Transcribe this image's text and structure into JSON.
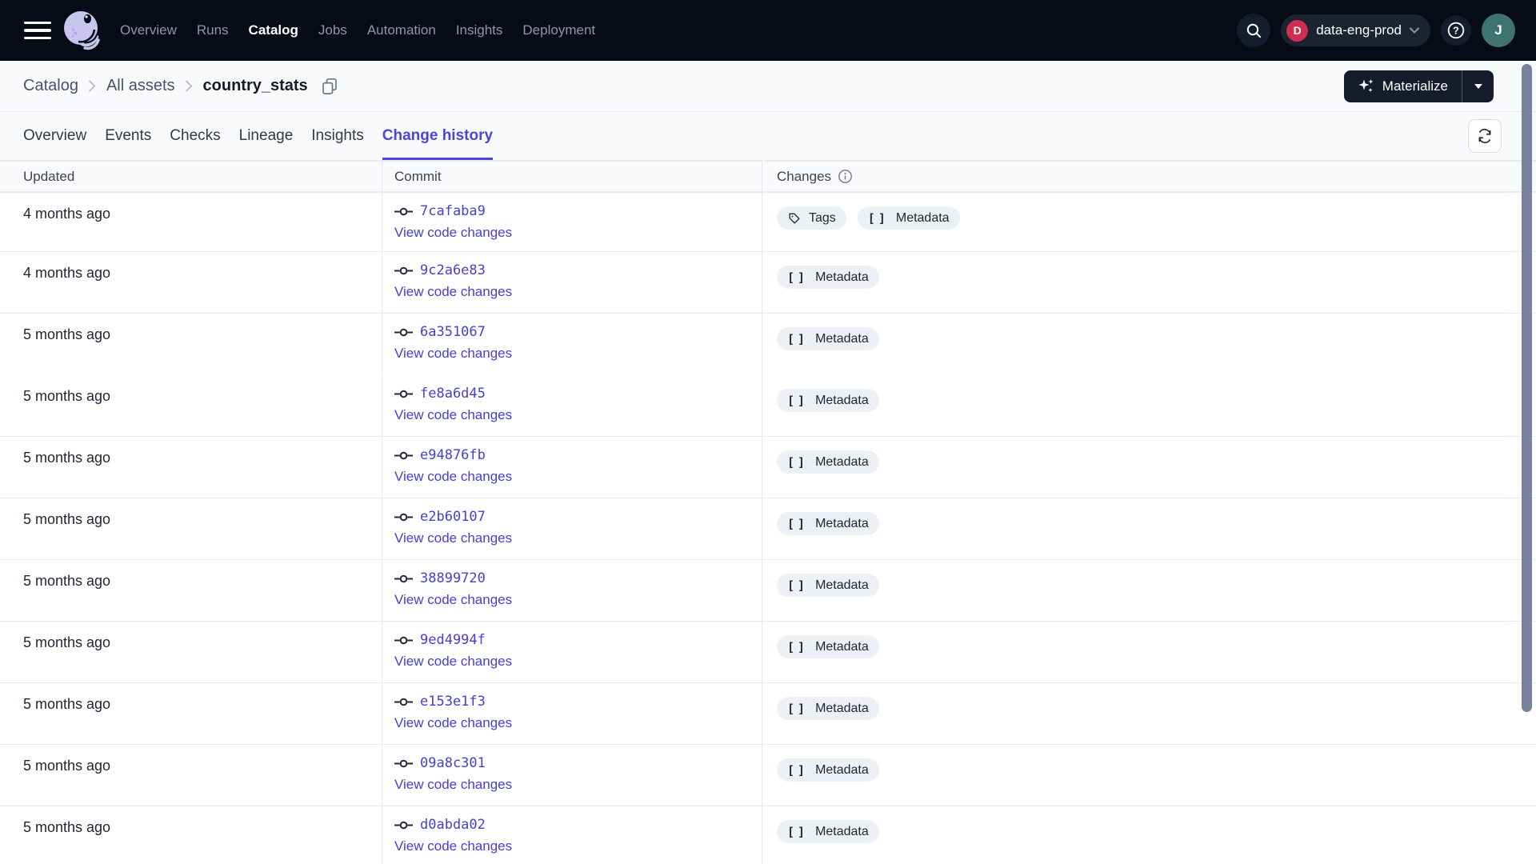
{
  "nav": {
    "items": [
      {
        "label": "Overview",
        "active": false
      },
      {
        "label": "Runs",
        "active": false
      },
      {
        "label": "Catalog",
        "active": true
      },
      {
        "label": "Jobs",
        "active": false
      },
      {
        "label": "Automation",
        "active": false
      },
      {
        "label": "Insights",
        "active": false
      },
      {
        "label": "Deployment",
        "active": false
      }
    ],
    "deployment": {
      "initial": "D",
      "label": "data-eng-prod"
    },
    "avatar_initial": "J"
  },
  "breadcrumb": {
    "links": [
      {
        "label": "Catalog"
      },
      {
        "label": "All assets"
      }
    ],
    "current": "country_stats"
  },
  "actions": {
    "materialize_label": "Materialize"
  },
  "tabs": [
    {
      "label": "Overview",
      "active": false
    },
    {
      "label": "Events",
      "active": false
    },
    {
      "label": "Checks",
      "active": false
    },
    {
      "label": "Lineage",
      "active": false
    },
    {
      "label": "Insights",
      "active": false
    },
    {
      "label": "Change history",
      "active": true
    }
  ],
  "table": {
    "columns": {
      "updated": "Updated",
      "commit": "Commit",
      "changes": "Changes"
    },
    "view_code_changes_label": "View code changes",
    "rows": [
      {
        "updated": "4 months ago",
        "commit": "7cafaba9",
        "changes": [
          {
            "type": "tags",
            "label": "Tags"
          },
          {
            "type": "metadata",
            "label": "Metadata"
          }
        ]
      },
      {
        "updated": "4 months ago",
        "commit": "9c2a6e83",
        "changes": [
          {
            "type": "metadata",
            "label": "Metadata"
          }
        ]
      },
      {
        "updated": "5 months ago",
        "commit": "6a351067",
        "changes": [
          {
            "type": "metadata",
            "label": "Metadata"
          }
        ]
      },
      {
        "updated": "5 months ago",
        "commit": "fe8a6d45",
        "separator_above": false,
        "changes": [
          {
            "type": "metadata",
            "label": "Metadata"
          }
        ]
      },
      {
        "updated": "5 months ago",
        "commit": "e94876fb",
        "changes": [
          {
            "type": "metadata",
            "label": "Metadata"
          }
        ]
      },
      {
        "updated": "5 months ago",
        "commit": "e2b60107",
        "changes": [
          {
            "type": "metadata",
            "label": "Metadata"
          }
        ]
      },
      {
        "updated": "5 months ago",
        "commit": "38899720",
        "changes": [
          {
            "type": "metadata",
            "label": "Metadata"
          }
        ]
      },
      {
        "updated": "5 months ago",
        "commit": "9ed4994f",
        "changes": [
          {
            "type": "metadata",
            "label": "Metadata"
          }
        ]
      },
      {
        "updated": "5 months ago",
        "commit": "e153e1f3",
        "changes": [
          {
            "type": "metadata",
            "label": "Metadata"
          }
        ]
      },
      {
        "updated": "5 months ago",
        "commit": "09a8c301",
        "changes": [
          {
            "type": "metadata",
            "label": "Metadata"
          }
        ]
      },
      {
        "updated": "5 months ago",
        "commit": "d0abda02",
        "changes": [
          {
            "type": "metadata",
            "label": "Metadata"
          }
        ]
      }
    ]
  },
  "icons": {
    "menu": "hamburger-icon",
    "logo": "dagster-logo",
    "search": "search-icon",
    "help": "help-icon",
    "chevron_down": "chevron-down-icon",
    "copy": "copy-icon",
    "sparkle": "sparkle-icon",
    "caret_down": "caret-down-icon",
    "refresh": "refresh-icon",
    "info": "info-icon",
    "commit": "git-commit-icon",
    "tag": "tag-icon",
    "brackets": "brackets-icon"
  },
  "colors": {
    "accent": "#4F43DD",
    "link": "#4640CE",
    "nav_bg": "#070B16",
    "page_bg": "#F9FAFC",
    "deployment_badge": "#CE2D4F",
    "avatar": "#3E7370",
    "badge_bg": "#EDF0F5",
    "scroll_thumb": "#76839B"
  }
}
